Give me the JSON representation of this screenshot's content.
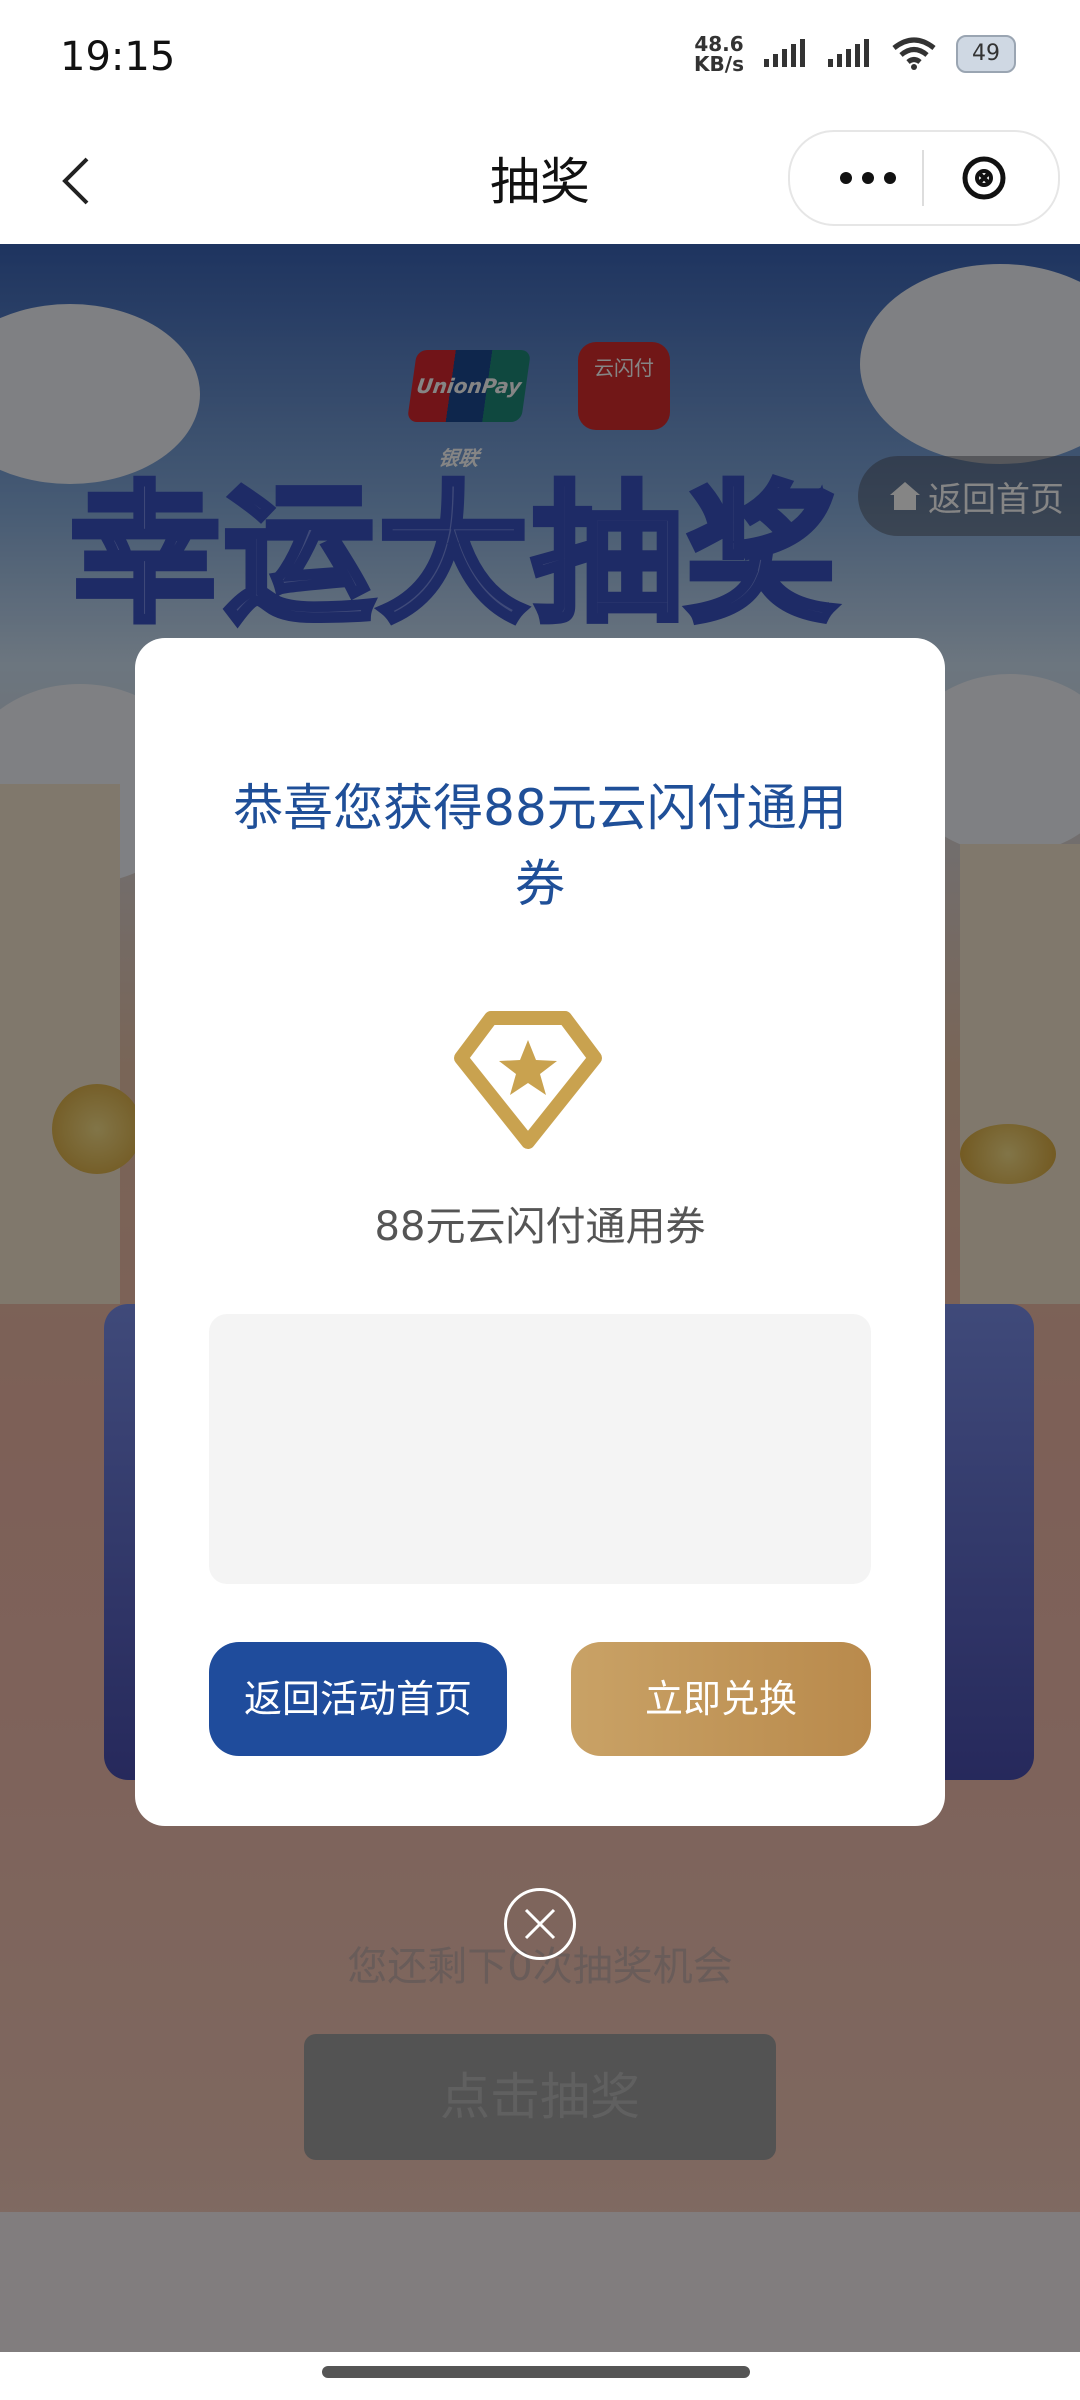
{
  "status_bar": {
    "time": "19:15",
    "net_speed_value": "48.6",
    "net_speed_unit": "KB/s",
    "battery": "49"
  },
  "nav": {
    "title": "抽奖"
  },
  "background": {
    "logo_unionpay": "UnionPay 银联",
    "logo_ysf": "云闪付",
    "big_title": "幸运大抽奖",
    "home_button": "返回首页",
    "remaining_text": "您还剩下0次抽奖机会",
    "draw_button": "点击抽奖"
  },
  "modal": {
    "title": "恭喜您获得88元云闪付通用券",
    "prize_name": "88元云闪付通用券",
    "back_button": "返回活动首页",
    "redeem_button": "立即兑换"
  },
  "colors": {
    "primary_blue": "#1f4c9c",
    "gold": "#c9a266"
  }
}
